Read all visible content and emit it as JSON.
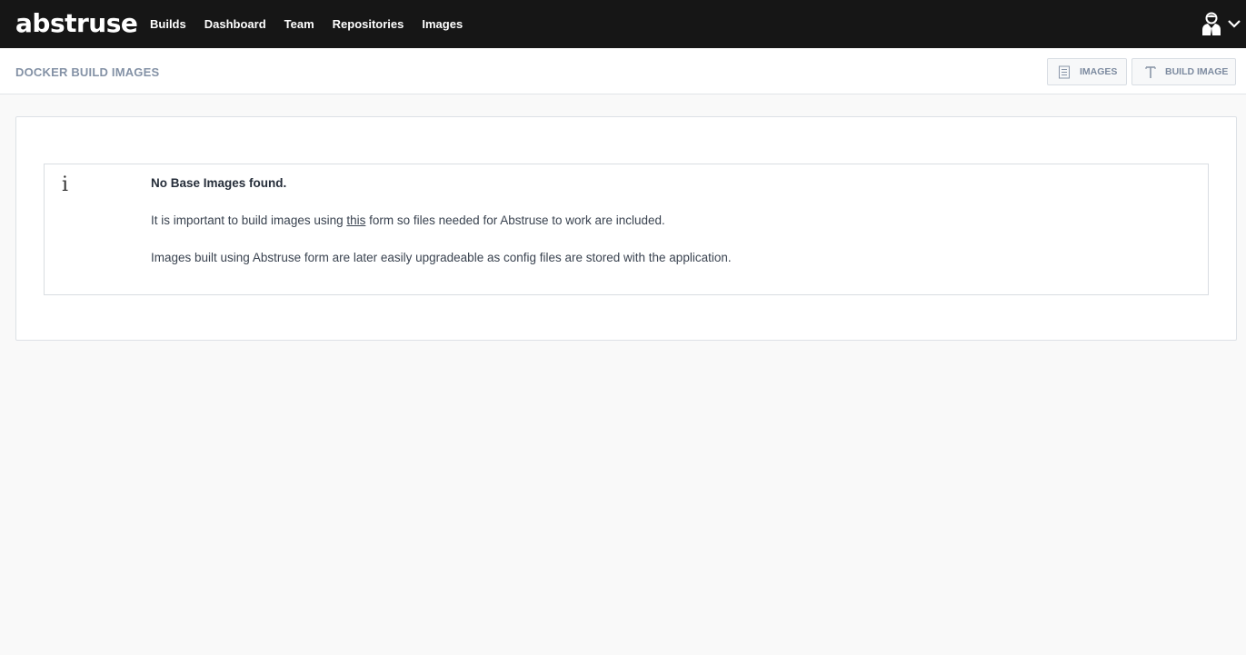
{
  "app": {
    "logo_text": "abstruse"
  },
  "nav": {
    "items": [
      {
        "label": "Builds"
      },
      {
        "label": "Dashboard"
      },
      {
        "label": "Team"
      },
      {
        "label": "Repositories"
      },
      {
        "label": "Images"
      }
    ]
  },
  "user_menu": {
    "icon": "user-icon",
    "dropdown_icon": "chevron-down-icon"
  },
  "header": {
    "title": "DOCKER BUILD IMAGES",
    "buttons": {
      "images": {
        "label": "IMAGES",
        "icon": "list-icon"
      },
      "build_image": {
        "label": "BUILD IMAGE",
        "icon": "type-t-icon"
      }
    }
  },
  "notice": {
    "icon": "info-icon",
    "icon_glyph": "i",
    "title": "No Base Images found.",
    "line1_before": "It is important to build images using ",
    "line1_link": "this",
    "line1_after": " form so files needed for Abstruse to work are included.",
    "line2": "Images built using Abstruse form are later easily upgradeable as config files are stored with the application."
  },
  "colors": {
    "topbar_bg": "#161616",
    "page_bg": "#f9f9f9",
    "muted_text": "#8492a6"
  }
}
